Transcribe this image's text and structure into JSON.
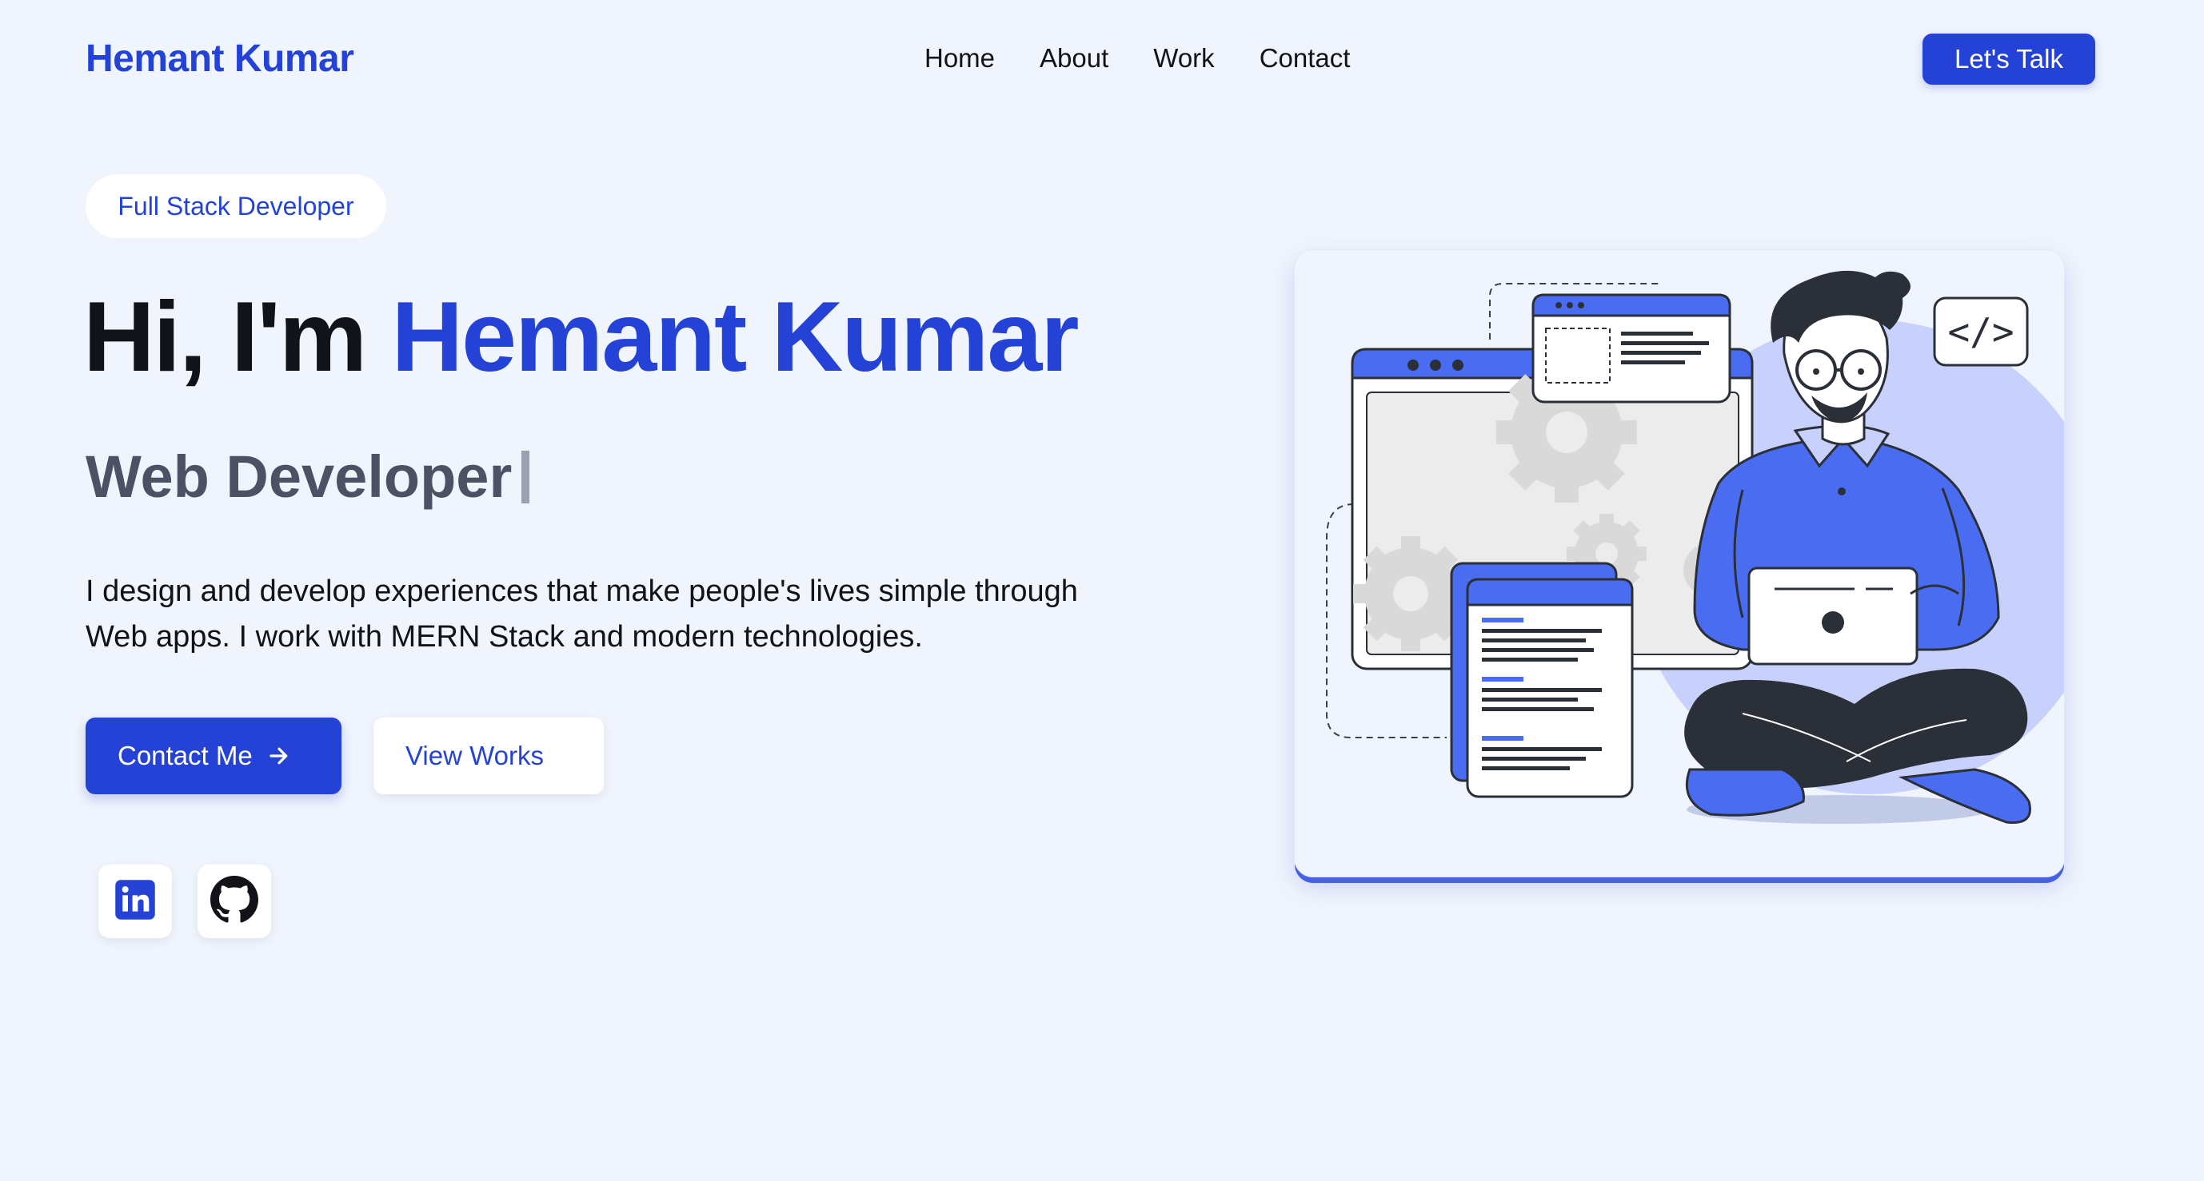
{
  "nav": {
    "logo": "Hemant Kumar",
    "links": [
      "Home",
      "About",
      "Work",
      "Contact"
    ],
    "cta": "Let's Talk"
  },
  "hero": {
    "badge": "Full Stack Developer",
    "greeting": "Hi, I'm ",
    "name": "Hemant Kumar",
    "role": "Web Developer",
    "description": "I design and develop experiences that make people's lives simple through Web apps. I work with MERN Stack and modern technologies.",
    "primary_button": "Contact Me",
    "secondary_button": "View Works"
  },
  "social": [
    {
      "icon": "linkedin-icon"
    },
    {
      "icon": "github-icon"
    }
  ],
  "illustration": {
    "code_tag": "</>"
  },
  "colors": {
    "accent": "#2443d6",
    "background": "#f0f4fc",
    "illustration_blue": "#4a6cf0"
  }
}
